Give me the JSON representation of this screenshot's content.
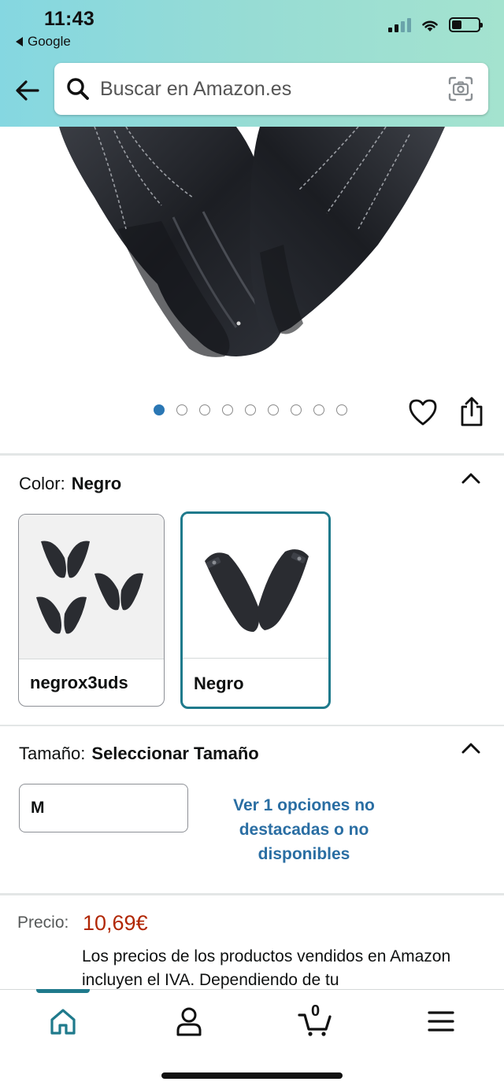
{
  "status_bar": {
    "time": "11:43",
    "back_app": "Google"
  },
  "search": {
    "placeholder": "Buscar en Amazon.es"
  },
  "gallery": {
    "image_count": 9,
    "active_index": 0
  },
  "color": {
    "label": "Color:",
    "selected": "Negro",
    "options": [
      {
        "label": "negrox3uds",
        "selected": false
      },
      {
        "label": "Negro",
        "selected": true
      }
    ]
  },
  "size": {
    "label": "Tamaño:",
    "selected": "Seleccionar Tamaño",
    "current_value": "M",
    "more_options": "Ver 1 opciones no destacadas o no disponibles"
  },
  "price": {
    "label": "Precio:",
    "value": "10,69€",
    "note": "Los precios de los productos vendidos en Amazon incluyen el IVA. Dependiendo de tu"
  },
  "nav": {
    "cart_count": "0",
    "items": [
      "home-icon",
      "account-icon",
      "cart-icon",
      "menu-icon"
    ]
  },
  "colors": {
    "accent": "#1f7a8c",
    "link": "#2a6ea3",
    "price": "#b12704",
    "header_gradient_start": "#85d7e1",
    "header_gradient_end": "#a4e3cf"
  }
}
